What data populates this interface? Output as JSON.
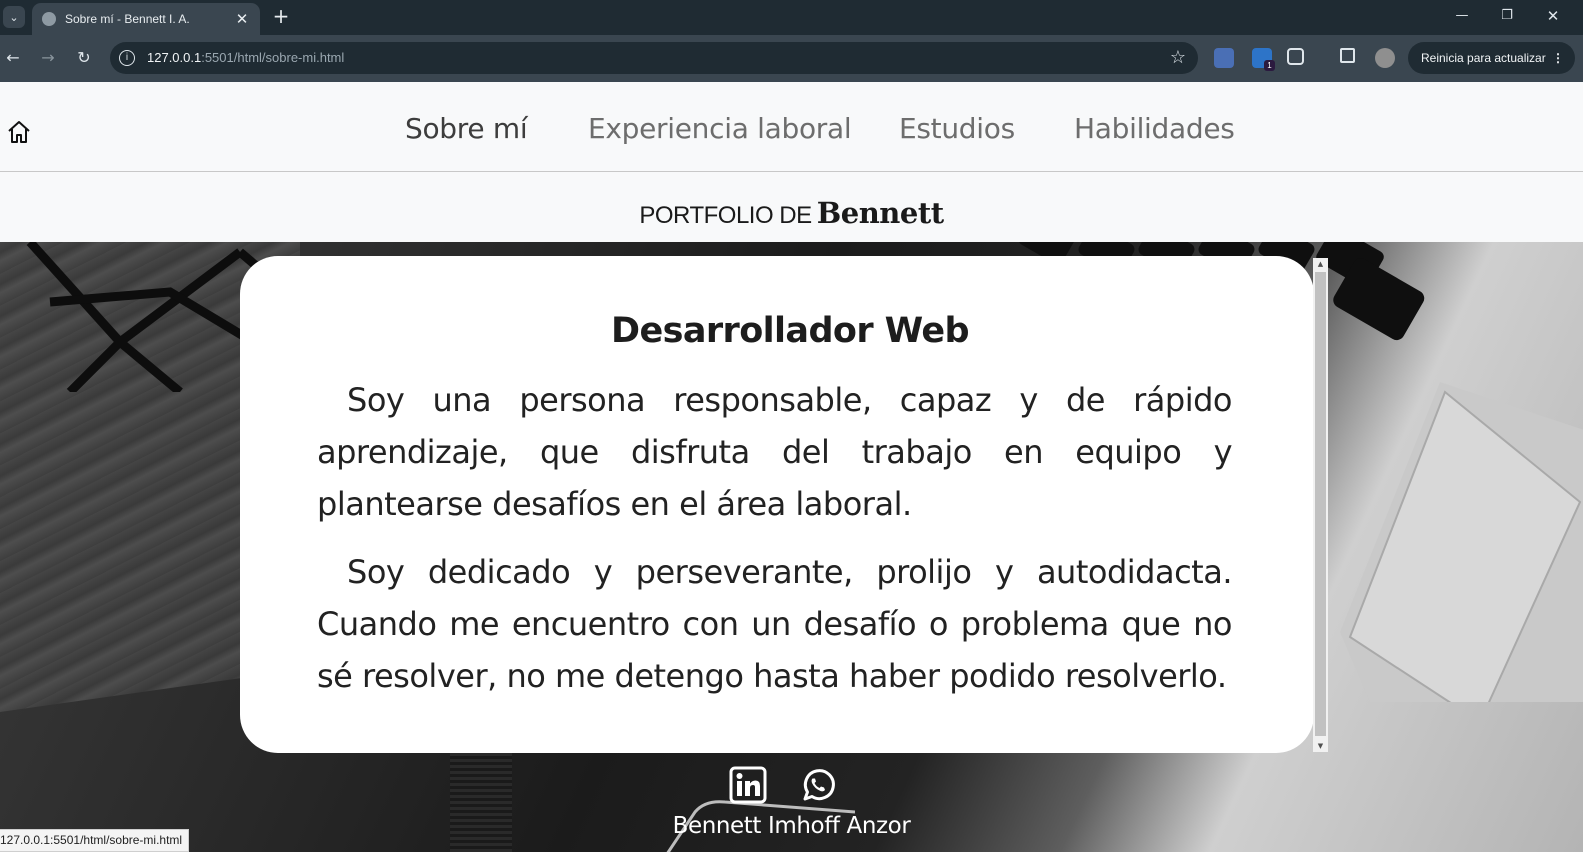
{
  "browser": {
    "tab_title": "Sobre mí - Bennett I. A.",
    "url_host": "127.0.0.1",
    "url_rest": ":5501/html/sobre-mi.html",
    "update_label": "Reinicia para actualizar",
    "extension_badge": "1",
    "status_url": "127.0.0.1:5501/html/sobre-mi.html",
    "accent_color": "#3a4650"
  },
  "nav": {
    "items": [
      {
        "label": "Sobre mí",
        "active": true
      },
      {
        "label": "Experiencia laboral",
        "active": false
      },
      {
        "label": "Estudios",
        "active": false
      },
      {
        "label": "Habilidades",
        "active": false
      }
    ]
  },
  "brand": {
    "prefix": "PORTFOLIO DE",
    "name": "Bennett"
  },
  "card": {
    "title": "Desarrollador Web",
    "paragraphs": [
      "Soy una persona responsable, capaz y de rápido aprendizaje, que disfruta del trabajo en equipo y plantearse desafíos en el área laboral.",
      "Soy dedicado y perseverante, prolijo y autodidacta. Cuando me encuentro con un desafío o problema que no sé resolver, no me detengo hasta haber podido resolverlo."
    ]
  },
  "footer": {
    "name": "Bennett Imhoff Anzor",
    "icons": [
      "linkedin-icon",
      "whatsapp-icon"
    ]
  }
}
